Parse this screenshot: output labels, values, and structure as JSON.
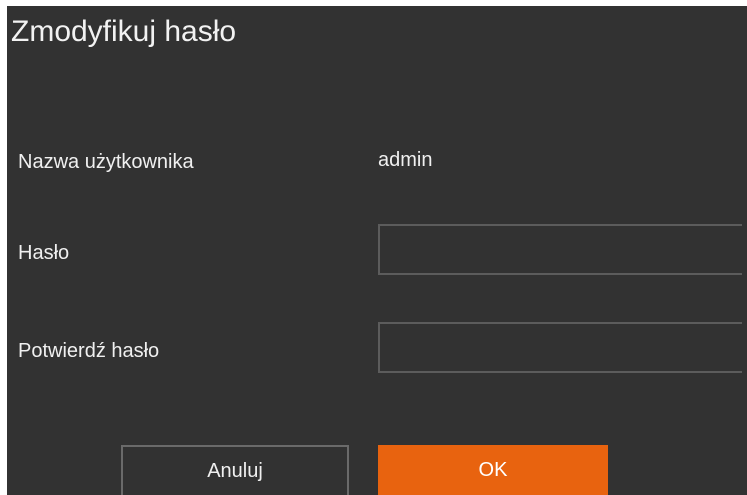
{
  "dialog": {
    "title": "Zmodyfikuj hasło",
    "fields": {
      "username": {
        "label": "Nazwa użytkownika",
        "value": "admin"
      },
      "password": {
        "label": "Hasło",
        "value": ""
      },
      "confirm_password": {
        "label": "Potwierdź hasło",
        "value": ""
      }
    },
    "buttons": {
      "cancel_label": "Anuluj",
      "ok_label": "OK"
    }
  },
  "colors": {
    "background": "#323232",
    "text": "#f0f0f0",
    "input_border": "#5c5c5c",
    "accent": "#e8630f"
  }
}
